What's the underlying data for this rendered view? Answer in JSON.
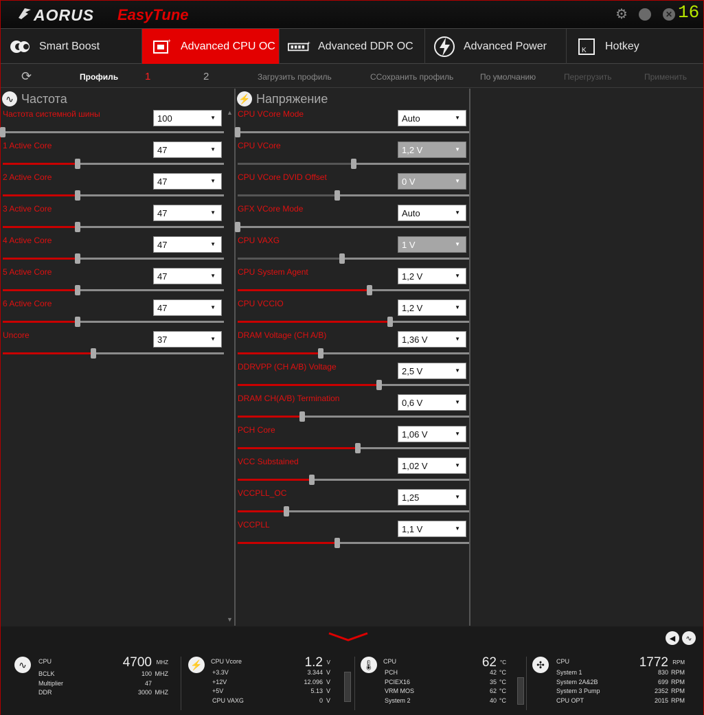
{
  "app": {
    "brand": "AORUS",
    "product": "EasyTune",
    "version": "16"
  },
  "tabs": [
    {
      "label": "Smart Boost",
      "icon": "smart-boost-icon"
    },
    {
      "label": "Advanced CPU OC",
      "icon": "cpu-chip-icon",
      "active": true
    },
    {
      "label": "Advanced DDR OC",
      "icon": "memory-module-icon"
    },
    {
      "label": "Advanced Power",
      "icon": "lightning-icon"
    },
    {
      "label": "Hotkey",
      "icon": "keyboard-key-icon"
    }
  ],
  "profilebar": {
    "profile_label": "Профиль",
    "profile_1": "1",
    "profile_2": "2",
    "load": "Загрузить профиль",
    "save": "ССохранить профиль",
    "default": "По умолчанию",
    "reload": "Перегрузить",
    "apply": "Применить"
  },
  "frequency": {
    "title": "Частота",
    "rows": [
      {
        "label": "Частота системной шины",
        "value": "100",
        "level": 0.0
      },
      {
        "label": "1 Active Core",
        "value": "47",
        "level": 0.34
      },
      {
        "label": "2 Active Core",
        "value": "47",
        "level": 0.34
      },
      {
        "label": "3 Active Core",
        "value": "47",
        "level": 0.34
      },
      {
        "label": "4 Active Core",
        "value": "47",
        "level": 0.34
      },
      {
        "label": "5 Active Core",
        "value": "47",
        "level": 0.34
      },
      {
        "label": "6 Active Core",
        "value": "47",
        "level": 0.34
      },
      {
        "label": "Uncore",
        "value": "37",
        "level": 0.41
      }
    ]
  },
  "voltage": {
    "title": "Напряжение",
    "rows": [
      {
        "label": "CPU VCore Mode",
        "value": "Auto",
        "level": 0.0,
        "disabled": false
      },
      {
        "label": "CPU VCore",
        "value": "1,2 V",
        "level": 0.5,
        "disabled": true
      },
      {
        "label": "CPU VCore DVID Offset",
        "value": "0 V",
        "level": 0.43,
        "disabled": true
      },
      {
        "label": "GFX VCore Mode",
        "value": "Auto",
        "level": 0.0,
        "disabled": false
      },
      {
        "label": "CPU VAXG",
        "value": "1 V",
        "level": 0.45,
        "disabled": true
      },
      {
        "label": "CPU System Agent",
        "value": "1,2 V",
        "level": 0.57,
        "disabled": false
      },
      {
        "label": "CPU VCCIO",
        "value": "1,2 V",
        "level": 0.66,
        "disabled": false
      },
      {
        "label": "DRAM Voltage (CH A/B)",
        "value": "1,36 V",
        "level": 0.36,
        "disabled": false
      },
      {
        "label": "DDRVPP (CH A/B) Voltage",
        "value": "2,5 V",
        "level": 0.61,
        "disabled": false
      },
      {
        "label": "DRAM CH(A/B) Termination",
        "value": "0,6 V",
        "level": 0.28,
        "disabled": false
      },
      {
        "label": "PCH Core",
        "value": "1,06 V",
        "level": 0.52,
        "disabled": false
      },
      {
        "label": "VCC Substained",
        "value": "1,02 V",
        "level": 0.32,
        "disabled": false
      },
      {
        "label": "VCCPLL_OC",
        "value": "1,25",
        "level": 0.21,
        "disabled": false
      },
      {
        "label": "VCCPLL",
        "value": "1,1 V",
        "level": 0.43,
        "disabled": false
      }
    ]
  },
  "monitor": {
    "freq": {
      "head_label": "CPU",
      "head_value": "4700",
      "head_unit": "MHZ",
      "items": [
        {
          "l": "BCLK",
          "v": "100",
          "u": "MHZ"
        },
        {
          "l": "Multiplier",
          "v": "47",
          "u": ""
        },
        {
          "l": "DDR",
          "v": "3000",
          "u": "MHZ"
        }
      ]
    },
    "volt": {
      "head_label": "CPU Vcore",
      "head_value": "1.2",
      "head_unit": "V",
      "items": [
        {
          "l": "+3.3V",
          "v": "3.344",
          "u": "V"
        },
        {
          "l": "+12V",
          "v": "12.096",
          "u": "V"
        },
        {
          "l": "+5V",
          "v": "5.13",
          "u": "V"
        },
        {
          "l": "CPU VAXG",
          "v": "0",
          "u": "V"
        }
      ]
    },
    "temp": {
      "head_label": "CPU",
      "head_value": "62",
      "head_unit": "°C",
      "items": [
        {
          "l": "PCH",
          "v": "42",
          "u": "°C"
        },
        {
          "l": "PCIEX16",
          "v": "35",
          "u": "°C"
        },
        {
          "l": "VRM MOS",
          "v": "62",
          "u": "°C"
        },
        {
          "l": "System 2",
          "v": "40",
          "u": "°C"
        }
      ]
    },
    "fan": {
      "head_label": "CPU",
      "head_value": "1772",
      "head_unit": "RPM",
      "items": [
        {
          "l": "System 1",
          "v": "830",
          "u": "RPM"
        },
        {
          "l": "System 2A&2B",
          "v": "699",
          "u": "RPM"
        },
        {
          "l": "System 3 Pump",
          "v": "2352",
          "u": "RPM"
        },
        {
          "l": "CPU OPT",
          "v": "2015",
          "u": "RPM"
        }
      ]
    }
  },
  "colors": {
    "accent": "#e30000",
    "label_red": "#e01010",
    "version_green": "#b7e800"
  }
}
